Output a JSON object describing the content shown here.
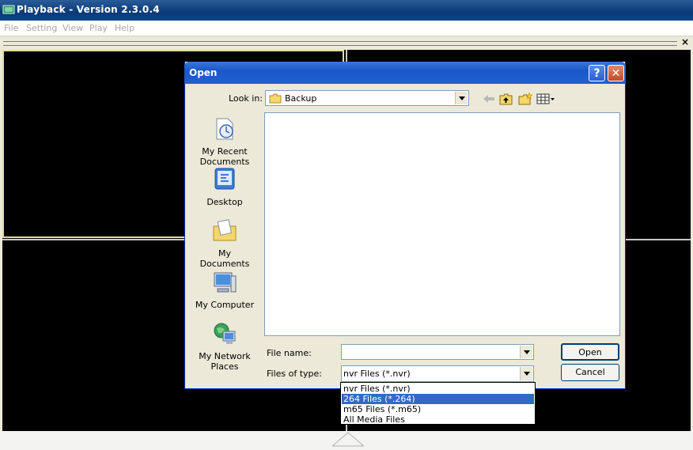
{
  "app": {
    "title": "Playback - Version 2.3.0.4",
    "menu": [
      "File",
      "Setting",
      "View",
      "Play",
      "Help"
    ]
  },
  "dialog": {
    "title": "Open",
    "look_in_label": "Look in:",
    "look_in_value": "Backup",
    "places": [
      {
        "label": "My Recent Documents",
        "icon": "recent-documents-icon"
      },
      {
        "label": "Desktop",
        "icon": "desktop-icon"
      },
      {
        "label": "My Documents",
        "icon": "my-documents-icon"
      },
      {
        "label": "My Computer",
        "icon": "my-computer-icon"
      },
      {
        "label": "My Network Places",
        "icon": "network-places-icon"
      }
    ],
    "file_name_label": "File name:",
    "file_name_value": "",
    "files_of_type_label": "Files of type:",
    "files_of_type_value": "nvr Files (*.nvr)",
    "open_button": "Open",
    "cancel_button": "Cancel",
    "type_options": [
      "nvr Files (*.nvr)",
      "264 Files (*.264)",
      "m65 Files (*.m65)",
      "All Media Files"
    ],
    "highlighted_option_index": 1
  },
  "colors": {
    "app_title_bg": "#0a3a78",
    "dialog_title_bg": "#2160cf",
    "selected_pane_border": "#e0dc9c",
    "selection_highlight": "#316ac5"
  }
}
